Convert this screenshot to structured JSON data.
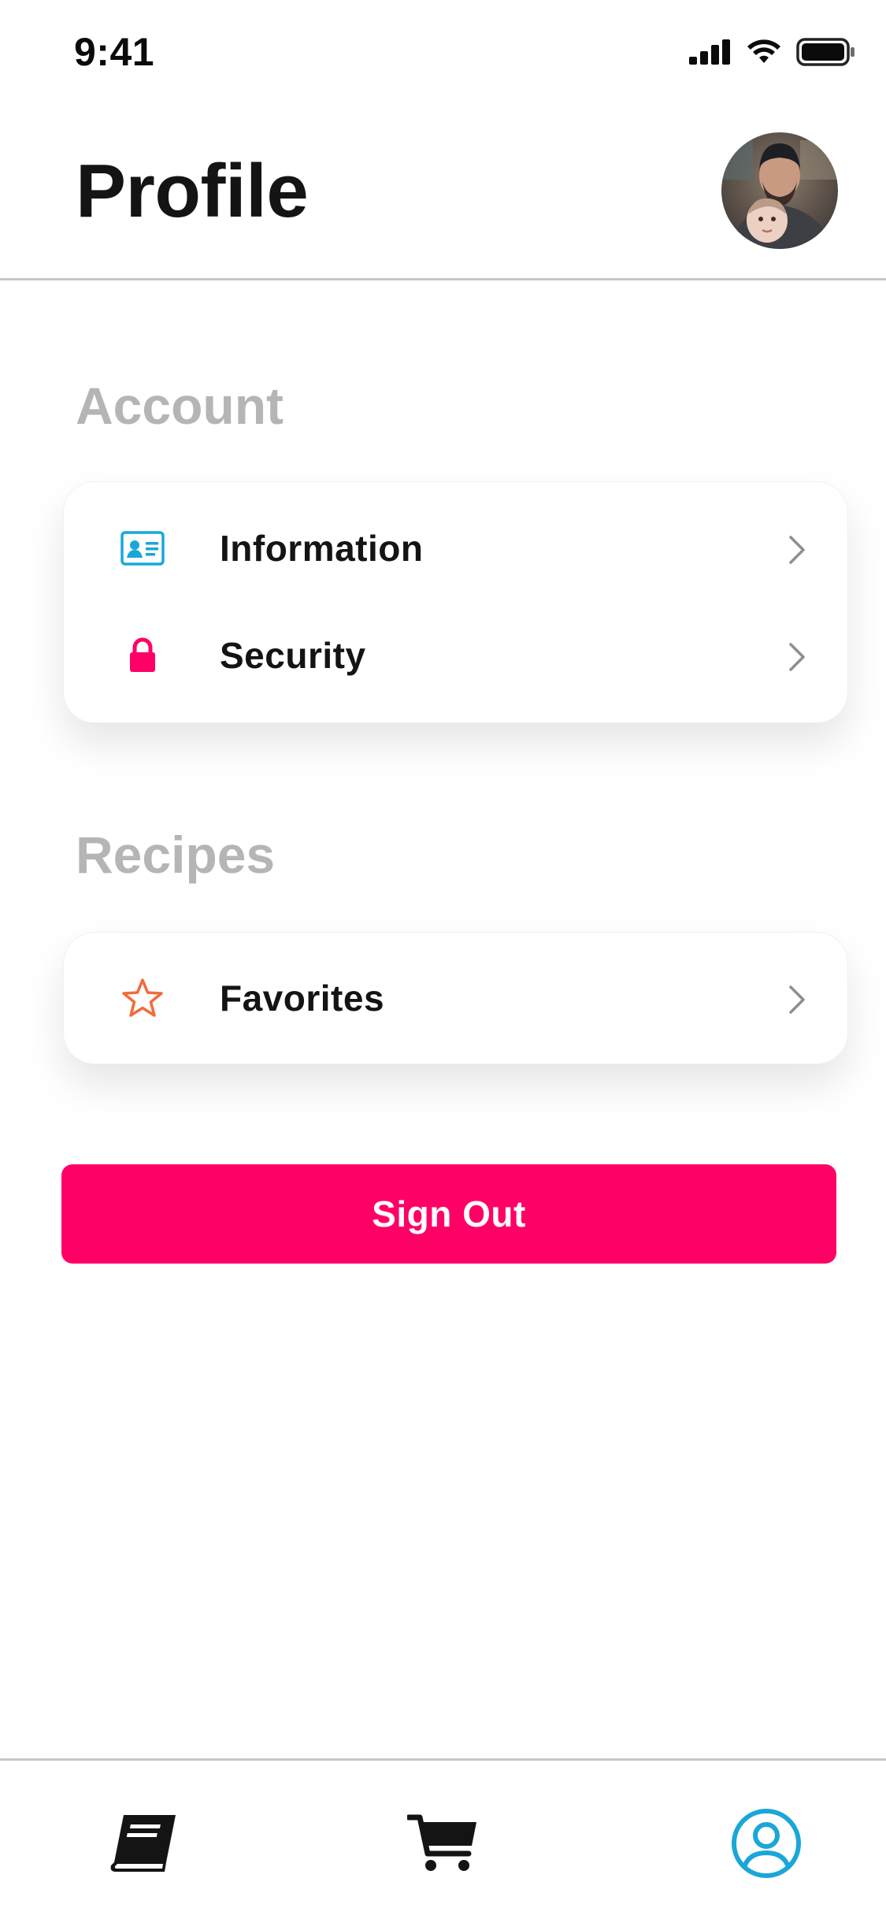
{
  "status_bar": {
    "time": "9:41",
    "icons": [
      "signal-icon",
      "wifi-icon",
      "battery-icon"
    ]
  },
  "header": {
    "title": "Profile",
    "avatar": "avatar"
  },
  "sections": [
    {
      "heading": "Account",
      "items": [
        {
          "label": "Information",
          "icon": "id-card-icon",
          "icon_color": "#1aa7d8"
        },
        {
          "label": "Security",
          "icon": "lock-icon",
          "icon_color": "#ff0066"
        }
      ]
    },
    {
      "heading": "Recipes",
      "items": [
        {
          "label": "Favorites",
          "icon": "star-icon",
          "icon_color": "#f26b3a"
        }
      ]
    }
  ],
  "sign_out": {
    "label": "Sign Out",
    "color": "#ff0066"
  },
  "tab_bar": {
    "tabs": [
      {
        "name": "recipes",
        "icon": "book-icon",
        "active": false,
        "color": "#141414"
      },
      {
        "name": "cart",
        "icon": "cart-icon",
        "active": false,
        "color": "#141414"
      },
      {
        "name": "profile",
        "icon": "user-circle-icon",
        "active": true,
        "color": "#1aa7d8"
      }
    ]
  }
}
